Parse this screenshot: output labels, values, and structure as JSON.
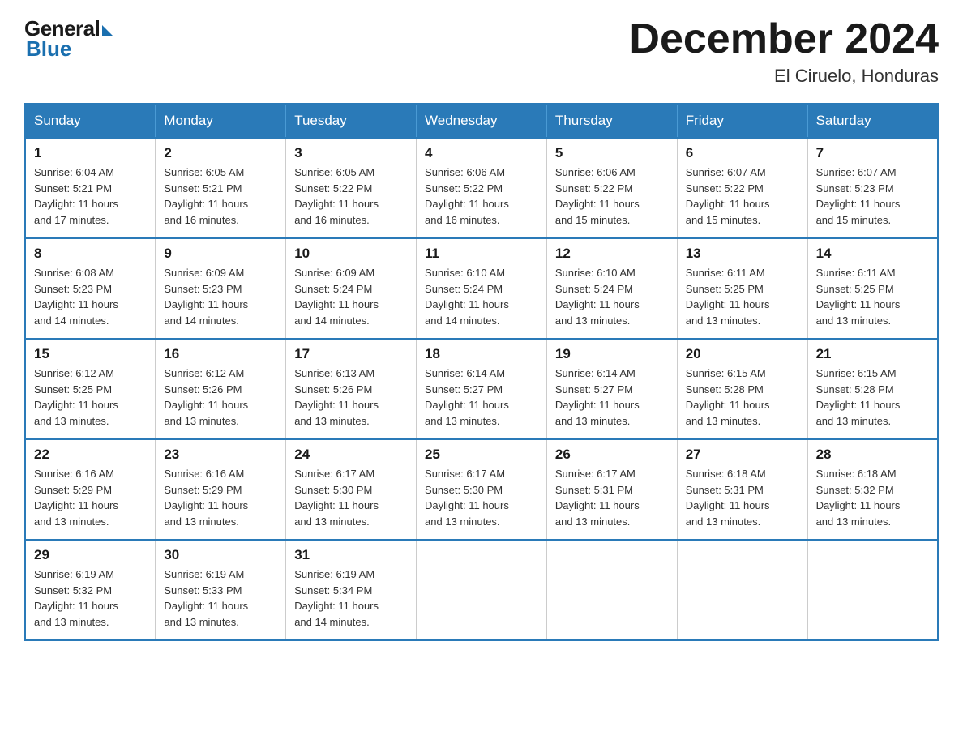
{
  "logo": {
    "general": "General",
    "blue": "Blue"
  },
  "header": {
    "month": "December 2024",
    "location": "El Ciruelo, Honduras"
  },
  "weekdays": [
    "Sunday",
    "Monday",
    "Tuesday",
    "Wednesday",
    "Thursday",
    "Friday",
    "Saturday"
  ],
  "weeks": [
    [
      {
        "day": "1",
        "sunrise": "6:04 AM",
        "sunset": "5:21 PM",
        "daylight": "11 hours and 17 minutes."
      },
      {
        "day": "2",
        "sunrise": "6:05 AM",
        "sunset": "5:21 PM",
        "daylight": "11 hours and 16 minutes."
      },
      {
        "day": "3",
        "sunrise": "6:05 AM",
        "sunset": "5:22 PM",
        "daylight": "11 hours and 16 minutes."
      },
      {
        "day": "4",
        "sunrise": "6:06 AM",
        "sunset": "5:22 PM",
        "daylight": "11 hours and 16 minutes."
      },
      {
        "day": "5",
        "sunrise": "6:06 AM",
        "sunset": "5:22 PM",
        "daylight": "11 hours and 15 minutes."
      },
      {
        "day": "6",
        "sunrise": "6:07 AM",
        "sunset": "5:22 PM",
        "daylight": "11 hours and 15 minutes."
      },
      {
        "day": "7",
        "sunrise": "6:07 AM",
        "sunset": "5:23 PM",
        "daylight": "11 hours and 15 minutes."
      }
    ],
    [
      {
        "day": "8",
        "sunrise": "6:08 AM",
        "sunset": "5:23 PM",
        "daylight": "11 hours and 14 minutes."
      },
      {
        "day": "9",
        "sunrise": "6:09 AM",
        "sunset": "5:23 PM",
        "daylight": "11 hours and 14 minutes."
      },
      {
        "day": "10",
        "sunrise": "6:09 AM",
        "sunset": "5:24 PM",
        "daylight": "11 hours and 14 minutes."
      },
      {
        "day": "11",
        "sunrise": "6:10 AM",
        "sunset": "5:24 PM",
        "daylight": "11 hours and 14 minutes."
      },
      {
        "day": "12",
        "sunrise": "6:10 AM",
        "sunset": "5:24 PM",
        "daylight": "11 hours and 13 minutes."
      },
      {
        "day": "13",
        "sunrise": "6:11 AM",
        "sunset": "5:25 PM",
        "daylight": "11 hours and 13 minutes."
      },
      {
        "day": "14",
        "sunrise": "6:11 AM",
        "sunset": "5:25 PM",
        "daylight": "11 hours and 13 minutes."
      }
    ],
    [
      {
        "day": "15",
        "sunrise": "6:12 AM",
        "sunset": "5:25 PM",
        "daylight": "11 hours and 13 minutes."
      },
      {
        "day": "16",
        "sunrise": "6:12 AM",
        "sunset": "5:26 PM",
        "daylight": "11 hours and 13 minutes."
      },
      {
        "day": "17",
        "sunrise": "6:13 AM",
        "sunset": "5:26 PM",
        "daylight": "11 hours and 13 minutes."
      },
      {
        "day": "18",
        "sunrise": "6:14 AM",
        "sunset": "5:27 PM",
        "daylight": "11 hours and 13 minutes."
      },
      {
        "day": "19",
        "sunrise": "6:14 AM",
        "sunset": "5:27 PM",
        "daylight": "11 hours and 13 minutes."
      },
      {
        "day": "20",
        "sunrise": "6:15 AM",
        "sunset": "5:28 PM",
        "daylight": "11 hours and 13 minutes."
      },
      {
        "day": "21",
        "sunrise": "6:15 AM",
        "sunset": "5:28 PM",
        "daylight": "11 hours and 13 minutes."
      }
    ],
    [
      {
        "day": "22",
        "sunrise": "6:16 AM",
        "sunset": "5:29 PM",
        "daylight": "11 hours and 13 minutes."
      },
      {
        "day": "23",
        "sunrise": "6:16 AM",
        "sunset": "5:29 PM",
        "daylight": "11 hours and 13 minutes."
      },
      {
        "day": "24",
        "sunrise": "6:17 AM",
        "sunset": "5:30 PM",
        "daylight": "11 hours and 13 minutes."
      },
      {
        "day": "25",
        "sunrise": "6:17 AM",
        "sunset": "5:30 PM",
        "daylight": "11 hours and 13 minutes."
      },
      {
        "day": "26",
        "sunrise": "6:17 AM",
        "sunset": "5:31 PM",
        "daylight": "11 hours and 13 minutes."
      },
      {
        "day": "27",
        "sunrise": "6:18 AM",
        "sunset": "5:31 PM",
        "daylight": "11 hours and 13 minutes."
      },
      {
        "day": "28",
        "sunrise": "6:18 AM",
        "sunset": "5:32 PM",
        "daylight": "11 hours and 13 minutes."
      }
    ],
    [
      {
        "day": "29",
        "sunrise": "6:19 AM",
        "sunset": "5:32 PM",
        "daylight": "11 hours and 13 minutes."
      },
      {
        "day": "30",
        "sunrise": "6:19 AM",
        "sunset": "5:33 PM",
        "daylight": "11 hours and 13 minutes."
      },
      {
        "day": "31",
        "sunrise": "6:19 AM",
        "sunset": "5:34 PM",
        "daylight": "11 hours and 14 minutes."
      },
      null,
      null,
      null,
      null
    ]
  ],
  "labels": {
    "sunrise": "Sunrise:",
    "sunset": "Sunset:",
    "daylight": "Daylight:"
  }
}
